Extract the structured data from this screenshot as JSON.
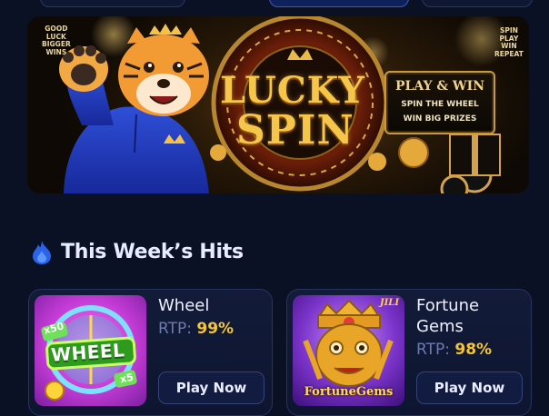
{
  "banner": {
    "left_note": [
      "GOOD",
      "LUCK",
      "BIGGER",
      "WINS"
    ],
    "right_note": [
      "SPIN",
      "PLAY",
      "WIN",
      "REPEAT"
    ],
    "title_line1": "LUCKY",
    "title_line2": "SPIN",
    "sign_title": "PLAY & WIN",
    "sign_line1": "SPIN THE WHEEL",
    "sign_line2": "WIN BIG PRIZES"
  },
  "section": {
    "title": "This Week’s Hits"
  },
  "games": [
    {
      "name": "Wheel",
      "rtp_label": "RTP:",
      "rtp_value": "99%",
      "button": "Play Now",
      "thumb_text": "WHEEL",
      "thumb_badge_1": "x50",
      "thumb_badge_2": "x5"
    },
    {
      "name_line1": "Fortune",
      "name_line2": "Gems",
      "rtp_label": "RTP:",
      "rtp_value": "98%",
      "button": "Play Now",
      "thumb_text": "FortuneGems",
      "thumb_badge": "JILI"
    }
  ],
  "colors": {
    "background": "#0b1124",
    "accent_gold": "#f4c43b",
    "card_border": "#28345e"
  }
}
